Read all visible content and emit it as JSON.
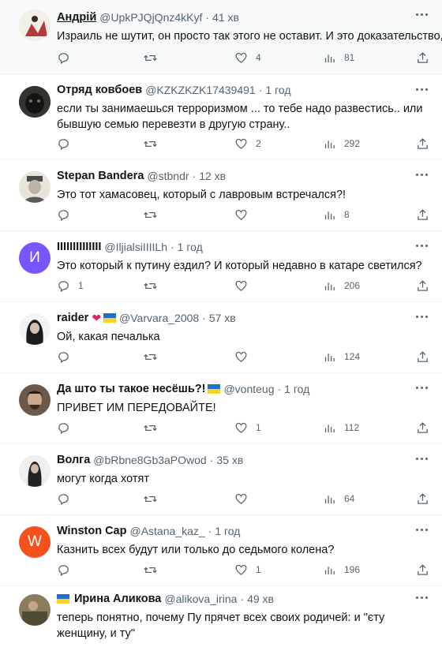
{
  "posts": [
    {
      "name": "Андрій",
      "handle": "@UpkPJQjQnz4kKyf",
      "time": "41 хв",
      "text": "Израиль не шутит, он просто так этого не оставит. И это доказательство,",
      "replies": "",
      "reposts": "",
      "likes": "4",
      "views": "81",
      "avatar_icon": "user-photo-avatar"
    },
    {
      "name": "Отряд ковбоев",
      "handle": "@KZKZKZK17439491",
      "time": "1 год",
      "text": "если ты занимаешься терроризмом ... то тебе надо развестись.. или бывшую семью перевезти в другую страну..",
      "replies": "",
      "reposts": "",
      "likes": "2",
      "views": "292",
      "avatar_icon": "user-photo-avatar"
    },
    {
      "name": "Stepan Bandera",
      "handle": "@stbndr",
      "time": "12 хв",
      "text": "Это тот хамасовец, который с лавровым встречался?!",
      "replies": "",
      "reposts": "",
      "likes": "",
      "views": "8",
      "avatar_icon": "user-photo-avatar"
    },
    {
      "name": "IIIIIIIIIIIIII",
      "handle": "@IljialsiIIIILh",
      "time": "1 год",
      "text": "Это который к путину ездил? И который недавно в катаре светился?",
      "replies": "1",
      "reposts": "",
      "likes": "",
      "views": "206",
      "avatar_letter": "И",
      "avatar_color": "#7856ff"
    },
    {
      "name": "raider",
      "handle": "@Varvara_2008",
      "time": "57 хв",
      "text": "Ой, какая печалька",
      "replies": "",
      "reposts": "",
      "likes": "",
      "views": "124",
      "avatar_icon": "user-photo-avatar"
    },
    {
      "name": "Да што ты такое несёшь?!",
      "handle": "@vonteug",
      "time": "1 год",
      "text": "ПРИВЕТ ИМ ПЕРЕДОВАЙТЕ!",
      "replies": "",
      "reposts": "",
      "likes": "1",
      "views": "112",
      "avatar_icon": "user-photo-avatar"
    },
    {
      "name": "Волга",
      "handle": "@bRbne8Gb3aPOwod",
      "time": "35 хв",
      "text": "могут когда хотят",
      "replies": "",
      "reposts": "",
      "likes": "",
      "views": "64",
      "avatar_icon": "user-photo-avatar"
    },
    {
      "name": "Winston Cap",
      "handle": "@Astana_kaz_",
      "time": "1 год",
      "text": "Казнить всех будут или только до седьмого колена?",
      "replies": "",
      "reposts": "",
      "likes": "1",
      "views": "196",
      "avatar_letter": "W",
      "avatar_color": "#f4511e"
    },
    {
      "name": "Ирина Аликова",
      "handle": "@alikova_irina",
      "time": "49 хв",
      "text": "теперь понятно, почему Пу прячет всех своих родичей: и \"єту женщину, и ту\"",
      "replies": "",
      "reposts": "",
      "likes": "",
      "views": "",
      "avatar_icon": "user-photo-avatar"
    }
  ],
  "colors": {
    "accent": "#1d9bf0",
    "muted": "#536471",
    "heart": "#e0245e",
    "flag_blue": "#1f6fd1",
    "flag_yellow": "#f8d42a"
  }
}
